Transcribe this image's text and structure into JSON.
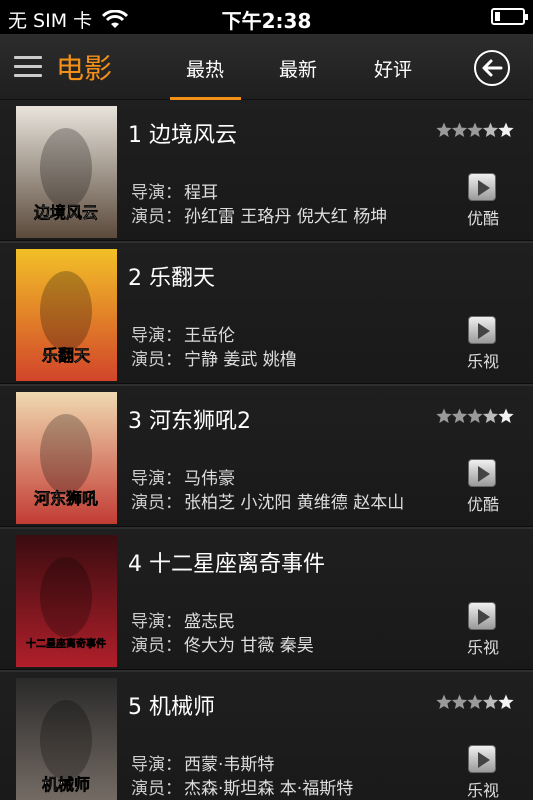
{
  "status_bar": {
    "carrier": "无 SIM 卡",
    "time": "下午2:38"
  },
  "nav": {
    "title": "电影",
    "tabs": [
      "最热",
      "最新",
      "好评"
    ],
    "active_tab": "最热"
  },
  "labels": {
    "director": "导演：",
    "cast": "演员："
  },
  "movies": [
    {
      "rank": "1",
      "title": "1 边境风云",
      "director": "程耳",
      "cast": "孙红雷 王珞丹 倪大红 杨坤",
      "source": "优酷",
      "rating": 3.5,
      "poster_colors": [
        "#e8e4dc",
        "#5b4a3c"
      ],
      "poster_text": "边境风云"
    },
    {
      "rank": "2",
      "title": "2 乐翻天",
      "director": "王岳伦",
      "cast": "宁静 姜武 姚橹",
      "source": "乐视",
      "rating": null,
      "poster_colors": [
        "#f2c027",
        "#d2452a"
      ],
      "poster_text": "乐翻天"
    },
    {
      "rank": "3",
      "title": "3 河东狮吼2",
      "director": "马伟豪",
      "cast": "张柏芝 小沈阳 黄维德 赵本山",
      "source": "优酷",
      "rating": 3.5,
      "poster_colors": [
        "#f0d9b0",
        "#c23c34"
      ],
      "poster_text": "河东狮吼"
    },
    {
      "rank": "4",
      "title": "4 十二星座离奇事件",
      "director": "盛志民",
      "cast": "佟大为 甘薇 秦昊",
      "source": "乐视",
      "rating": null,
      "poster_colors": [
        "#3a0c10",
        "#b01f2a"
      ],
      "poster_text": "十二星座离奇事件"
    },
    {
      "rank": "5",
      "title": "5 机械师",
      "director": "西蒙·韦斯特",
      "cast": "杰森·斯坦森 本·福斯特",
      "source": "乐视",
      "rating": 3.5,
      "poster_colors": [
        "#2a2a2a",
        "#7a7068"
      ],
      "poster_text": "机械师"
    }
  ]
}
